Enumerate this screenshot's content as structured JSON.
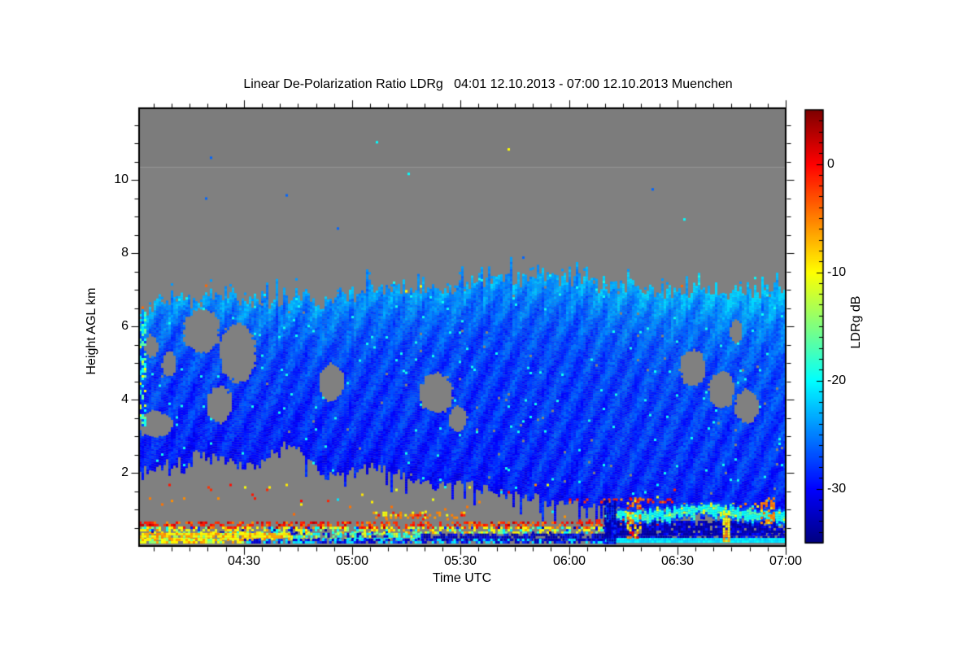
{
  "chart_data": {
    "type": "heatmap",
    "title": "Linear De-Polarization Ratio LDRg   04:01 12.10.2013 - 07:00 12.10.2013 Muenchen",
    "station": "Muenchen",
    "time_start": "04:01 12.10.2013",
    "time_end": "07:00 12.10.2013",
    "xlabel": "Time UTC",
    "ylabel": "Height AGL km",
    "colorbar_label": "LDRg dB",
    "x_range_minutes": [
      0,
      179
    ],
    "x_major_ticks": [
      {
        "label": "04:30",
        "t": 29
      },
      {
        "label": "05:00",
        "t": 59
      },
      {
        "label": "05:30",
        "t": 89
      },
      {
        "label": "06:00",
        "t": 119
      },
      {
        "label": "06:30",
        "t": 149
      },
      {
        "label": "07:00",
        "t": 179
      }
    ],
    "x_minor_step_min": 5,
    "x_minor_phase_min": 4,
    "y_range_km": [
      0,
      12
    ],
    "y_major_ticks": [
      {
        "label": "2",
        "v": 2
      },
      {
        "label": "4",
        "v": 4
      },
      {
        "label": "6",
        "v": 6
      },
      {
        "label": "8",
        "v": 8
      },
      {
        "label": "10",
        "v": 10
      }
    ],
    "y_minor_step_km": 0.5,
    "colorbar_range_db": [
      5,
      -35
    ],
    "colorbar_ticks": [
      {
        "label": "0",
        "v": 0
      },
      {
        "label": "-10",
        "v": -10
      },
      {
        "label": "-20",
        "v": -20
      },
      {
        "label": "-30",
        "v": -30
      }
    ],
    "colorbar_minor_step_db": 1,
    "colormap": "jet",
    "nodata_color": "#808080",
    "nodata_color_upper": "#7c7c7c",
    "upper_band_boundary_km": 10.35,
    "legend_position": "right",
    "grid": false,
    "cloud": {
      "description": "ice cloud LDR field, mostly -24 to -33 dB (blue), ragged edges, down-left fall streaks",
      "base_db": -28.3,
      "top_lighten_db": 4.8,
      "streak_amp_db": 1.15,
      "noise_amp_db": 2.2,
      "top_profile": [
        [
          0,
          6.3
        ],
        [
          5,
          6.6
        ],
        [
          10,
          6.9
        ],
        [
          15,
          6.6
        ],
        [
          20,
          6.8
        ],
        [
          25,
          6.9
        ],
        [
          30,
          6.7
        ],
        [
          35,
          6.6
        ],
        [
          40,
          6.8
        ],
        [
          45,
          6.9
        ],
        [
          50,
          6.6
        ],
        [
          55,
          6.7
        ],
        [
          60,
          6.9
        ],
        [
          65,
          7.0
        ],
        [
          70,
          6.9
        ],
        [
          75,
          7.0
        ],
        [
          80,
          7.1
        ],
        [
          85,
          7.0
        ],
        [
          90,
          7.15
        ],
        [
          95,
          7.2
        ],
        [
          100,
          7.25
        ],
        [
          105,
          7.2
        ],
        [
          110,
          7.3
        ],
        [
          115,
          7.25
        ],
        [
          120,
          7.3
        ],
        [
          125,
          7.15
        ],
        [
          130,
          7.05
        ],
        [
          135,
          7.1
        ],
        [
          140,
          7.0
        ],
        [
          145,
          6.95
        ],
        [
          150,
          7.0
        ],
        [
          155,
          6.9
        ],
        [
          160,
          6.95
        ],
        [
          165,
          6.9
        ],
        [
          170,
          7.0
        ],
        [
          175,
          6.9
        ],
        [
          179,
          6.95
        ]
      ],
      "bottom_profile": [
        [
          0,
          2.1
        ],
        [
          5,
          2.2
        ],
        [
          10,
          2.3
        ],
        [
          15,
          2.6
        ],
        [
          20,
          2.4
        ],
        [
          25,
          2.3
        ],
        [
          30,
          2.2
        ],
        [
          35,
          2.5
        ],
        [
          40,
          2.8
        ],
        [
          45,
          2.6
        ],
        [
          50,
          2.1
        ],
        [
          55,
          1.95
        ],
        [
          60,
          2.05
        ],
        [
          65,
          2.2
        ],
        [
          70,
          2.1
        ],
        [
          75,
          1.9
        ],
        [
          80,
          1.75
        ],
        [
          85,
          1.6
        ],
        [
          90,
          1.75
        ],
        [
          95,
          1.65
        ],
        [
          100,
          1.5
        ],
        [
          105,
          1.4
        ],
        [
          110,
          1.3
        ],
        [
          115,
          1.15
        ],
        [
          120,
          1.25
        ],
        [
          125,
          1.1
        ],
        [
          130,
          0.95
        ],
        [
          135,
          1.0
        ],
        [
          140,
          0.9
        ],
        [
          145,
          0.95
        ],
        [
          150,
          0.9
        ],
        [
          155,
          0.92
        ],
        [
          160,
          0.88
        ],
        [
          165,
          0.92
        ],
        [
          170,
          0.88
        ],
        [
          175,
          0.9
        ],
        [
          179,
          0.88
        ]
      ],
      "holes": [
        [
          4,
          3.35,
          5,
          0.35
        ],
        [
          3,
          5.5,
          2,
          0.3
        ],
        [
          8,
          5.0,
          2,
          0.35
        ],
        [
          17,
          5.9,
          5,
          0.6
        ],
        [
          27,
          5.3,
          5,
          0.8
        ],
        [
          22,
          3.9,
          3.5,
          0.5
        ],
        [
          53,
          4.5,
          3.5,
          0.5
        ],
        [
          82,
          4.2,
          4.5,
          0.55
        ],
        [
          88,
          3.5,
          2.5,
          0.35
        ],
        [
          153,
          4.9,
          3.5,
          0.5
        ],
        [
          161,
          4.3,
          3.5,
          0.5
        ],
        [
          168,
          3.85,
          3.5,
          0.45
        ],
        [
          165,
          5.9,
          1.8,
          0.3
        ]
      ]
    },
    "surface_layers": [
      {
        "name": "sparse-red-specks-left",
        "t": [
          0,
          65
        ],
        "h": [
          1.2,
          1.33
        ],
        "p": 0.05,
        "db": [
          [
            -1,
            1
          ],
          [
            -5,
            0.5
          ]
        ]
      },
      {
        "name": "red-dashes-0612-right",
        "t": [
          119,
          147
        ],
        "h": [
          1.18,
          1.3
        ],
        "p": 0.3,
        "db": [
          [
            -1,
            1
          ],
          [
            -5,
            0.5
          ]
        ]
      },
      {
        "name": "orange-dashes-mid",
        "t": [
          64,
          90
        ],
        "h": [
          0.78,
          0.94
        ],
        "p": 0.3,
        "db": [
          [
            -5,
            1
          ],
          [
            -1,
            0.5
          ],
          [
            -10,
            0.3
          ]
        ]
      },
      {
        "name": "orange-specks-upper-right",
        "t": [
          150,
          179
        ],
        "h": [
          1.0,
          1.18
        ],
        "p": 0.12,
        "db": [
          [
            -5,
            1
          ],
          [
            -10,
            0.6
          ]
        ]
      },
      {
        "name": "red-dash-line",
        "t": [
          0,
          148
        ],
        "h": [
          0.53,
          0.67
        ],
        "p": 0.5,
        "db": [
          [
            -1,
            1
          ],
          [
            2,
            0.3
          ],
          [
            -5,
            0.4
          ]
        ]
      },
      {
        "name": "red-dash-line-2",
        "t": [
          119,
          137
        ],
        "h": [
          0.62,
          0.73
        ],
        "p": 0.45,
        "db": [
          [
            -1,
            1
          ]
        ]
      },
      {
        "name": "mixed-yellow-band",
        "t": [
          0,
          132
        ],
        "h": [
          0.36,
          0.53
        ],
        "p": 0.55,
        "db": [
          [
            -10,
            1
          ],
          [
            -15,
            0.5
          ],
          [
            -20,
            0.4
          ],
          [
            -6,
            0.3
          ],
          [
            -28,
            0.2
          ],
          [
            -33,
            0.15
          ]
        ]
      },
      {
        "name": "yellow-orange-left",
        "t": [
          0,
          42
        ],
        "h": [
          0.2,
          0.36
        ],
        "p": 0.88,
        "db": [
          [
            -10,
            1
          ],
          [
            -6,
            0.7
          ],
          [
            -14,
            0.3
          ]
        ]
      },
      {
        "name": "cyan-yellow-mid",
        "t": [
          42,
          78
        ],
        "h": [
          0.2,
          0.36
        ],
        "p": 0.75,
        "db": [
          [
            -20,
            1
          ],
          [
            -11,
            0.6
          ],
          [
            -16,
            0.5
          ],
          [
            -32,
            0.4
          ]
        ]
      },
      {
        "name": "navy-checker-right",
        "t": [
          78,
          179
        ],
        "h": [
          0.18,
          0.34
        ],
        "p": 0.8,
        "db": [
          [
            -33,
            1
          ],
          [
            -29,
            0.3
          ]
        ]
      },
      {
        "name": "bottom-yellow-left",
        "t": [
          0,
          29
        ],
        "h": [
          0.07,
          0.2
        ],
        "p": 0.85,
        "db": [
          [
            -10,
            1
          ],
          [
            -15,
            0.6
          ],
          [
            -6,
            0.5
          ]
        ]
      },
      {
        "name": "bottom-navy-mid",
        "t": [
          29,
          129
        ],
        "h": [
          0.07,
          0.2
        ],
        "p": 0.75,
        "db": [
          [
            -32,
            1
          ],
          [
            -21,
            0.7
          ],
          [
            -28,
            0.5
          ]
        ]
      },
      {
        "name": "bottom-cyan-line-right",
        "t": [
          129,
          179
        ],
        "h": [
          0.11,
          0.22
        ],
        "p": 1.0,
        "db": [
          [
            -21,
            1
          ]
        ]
      },
      {
        "name": "navy-band-right",
        "t": [
          129,
          179
        ],
        "h": [
          0.33,
          0.69
        ],
        "p": 0.9,
        "db": [
          [
            -33,
            1
          ],
          [
            -30,
            0.3
          ]
        ]
      },
      {
        "name": "gray-scatter-zone",
        "t": [
          0,
          148
        ],
        "h": [
          0.7,
          1.7
        ],
        "p": 0.012,
        "db": [
          [
            -1,
            1
          ],
          [
            -5,
            1
          ],
          [
            -10,
            1
          ],
          [
            -20,
            0.7
          ]
        ]
      }
    ],
    "wavy_cyan_band": {
      "t": [
        129,
        179
      ],
      "center_h": 0.91,
      "amp_h": 0.09,
      "core_db": -19.5,
      "green_db": -16.5,
      "yellow_db": -11,
      "edge_db": -27
    },
    "vertical_streaks": [
      {
        "name": "navy-column",
        "t": [
          128.7,
          131.9
        ],
        "h": [
          0.11,
          1.25
        ],
        "p": 0.9,
        "db": [
          [
            -33,
            1
          ],
          [
            -29,
            0.4
          ]
        ]
      },
      {
        "name": "orange-column",
        "t": [
          135,
          139
        ],
        "h": [
          0.25,
          1.33
        ],
        "p": 0.5,
        "db": [
          [
            -5,
            1
          ],
          [
            -1,
            0.5
          ],
          [
            -10,
            0.6
          ]
        ]
      },
      {
        "name": "yellow-column",
        "t": [
          161.6,
          163.4
        ],
        "h": [
          0.11,
          0.97
        ],
        "p": 0.8,
        "db": [
          [
            -10,
            1
          ],
          [
            -6,
            0.5
          ]
        ]
      },
      {
        "name": "orange-specks-col",
        "t": [
          172,
          175.8
        ],
        "h": [
          0.65,
          1.33
        ],
        "p": 0.4,
        "db": [
          [
            -5,
            1
          ],
          [
            -10,
            0.5
          ]
        ]
      }
    ],
    "left_edge_artifact": {
      "t": [
        0,
        1.4
      ],
      "h": [
        3.2,
        6.4
      ],
      "p": 0.5,
      "db": [
        [
          -20,
          1
        ],
        [
          -16,
          0.7
        ],
        [
          -27,
          0.8
        ],
        [
          -11,
          0.3
        ]
      ]
    },
    "palette_anchors": {
      "plus5": "#7f0000",
      "zero": "#ff1a00",
      "minus10": "#ffff00",
      "minus20": "#00ffff",
      "minus30": "#0000ff",
      "minus35": "#000080"
    }
  }
}
